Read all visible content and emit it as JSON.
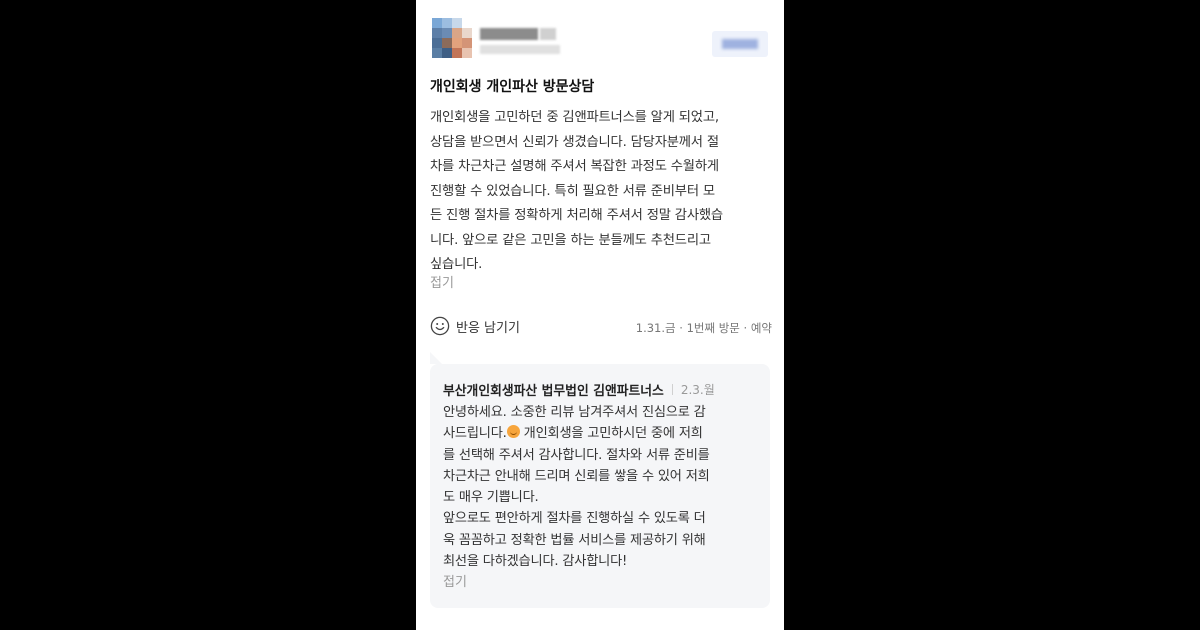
{
  "review": {
    "title": "개인회생 개인파산 방문상담",
    "body_lines": [
      "개인회생을 고민하던 중 김앤파트너스를 알게 되었고,",
      "상담을 받으면서 신뢰가 생겼습니다. 담당자분께서 절",
      "차를 차근차근 설명해 주셔서 복잡한 과정도 수월하게",
      "진행할 수 있었습니다. 특히 필요한 서류 준비부터 모",
      "든 진행 절차를 정확하게 처리해 주셔서 정말 감사했습",
      "니다. 앞으로 같은 고민을 하는 분들께도 추천드리고",
      "싶습니다."
    ],
    "fold_label": "접기",
    "react_label": "반응 남기기",
    "meta": "1.31.금 · 1번째 방문 · 예약"
  },
  "reply": {
    "name": "부산개인회생파산 법무법인 김앤파트너스",
    "date": "2.3.월",
    "line1": "안녕하세요. 소중한 리뷰 남겨주셔서 진심으로 감",
    "line2_before": "사드립니다.",
    "line2_after": " 개인회생을 고민하시던 중에 저희",
    "lines_rest": [
      "를 선택해 주셔서 감사합니다. 절차와 서류 준비를",
      "차근차근 안내해 드리며 신뢰를 쌓을 수 있어 저희",
      "도 매우 기쁩니다.",
      "앞으로도 편안하게 절차를 진행하실 수 있도록 더",
      "욱 꼼꼼하고 정확한 법률 서비스를 제공하기 위해",
      "최선을 다하겠습니다. 감사합니다!"
    ],
    "fold_label": "접기",
    "emoji_icon": "smiling-face-icon"
  },
  "colors": {
    "page_background": "#000000",
    "card_background": "#ffffff",
    "reply_background": "#f5f6f8",
    "muted_text": "#999999"
  }
}
